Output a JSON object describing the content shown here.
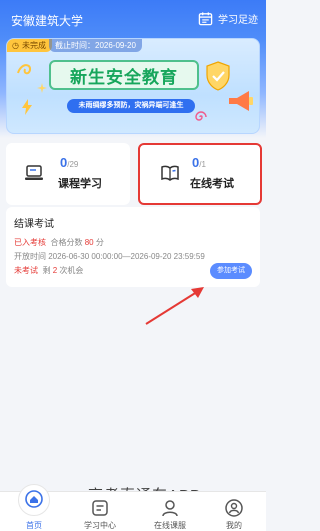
{
  "header": {
    "title": "安徽建筑大学",
    "footprint_label": "学习足迹"
  },
  "banner": {
    "status_label": "未完成",
    "deadline_label": "截止时间：2026-09-20",
    "headline": "新生安全教育",
    "subline": "未雨绸缪多预防，灾祸异端可逢生"
  },
  "modules": [
    {
      "count": "0",
      "total": "/29",
      "label": "课程学习",
      "icon": "laptop-icon"
    },
    {
      "count": "0",
      "total": "/1",
      "label": "在线考试",
      "icon": "book-icon"
    }
  ],
  "exam": {
    "title": "结课考试",
    "tag": "已入考核",
    "pass_prefix": "合格分数",
    "pass_score": "80",
    "pass_unit": "分",
    "time_prefix": "开放时间",
    "time_range": "2026-06-30 00:00:00—2026-09-20 23:59:59",
    "status": "未考试",
    "remain_prefix": "剩",
    "remain_count": "2",
    "remain_suffix": "次机会",
    "button_label": "参加考试"
  },
  "watermark": "高考直通车APP",
  "nav": {
    "items": [
      {
        "label": "首页",
        "icon": "home-icon",
        "active": true
      },
      {
        "label": "学习中心",
        "icon": "study-center-icon"
      },
      {
        "label": "在线课服",
        "icon": "customer-service-icon"
      },
      {
        "label": "我的",
        "icon": "profile-icon"
      }
    ]
  },
  "colors": {
    "primary": "#3b72e8",
    "highlight_border": "#e53935",
    "status_chip": "#ffc53d",
    "headline_green": "#17a65c"
  }
}
